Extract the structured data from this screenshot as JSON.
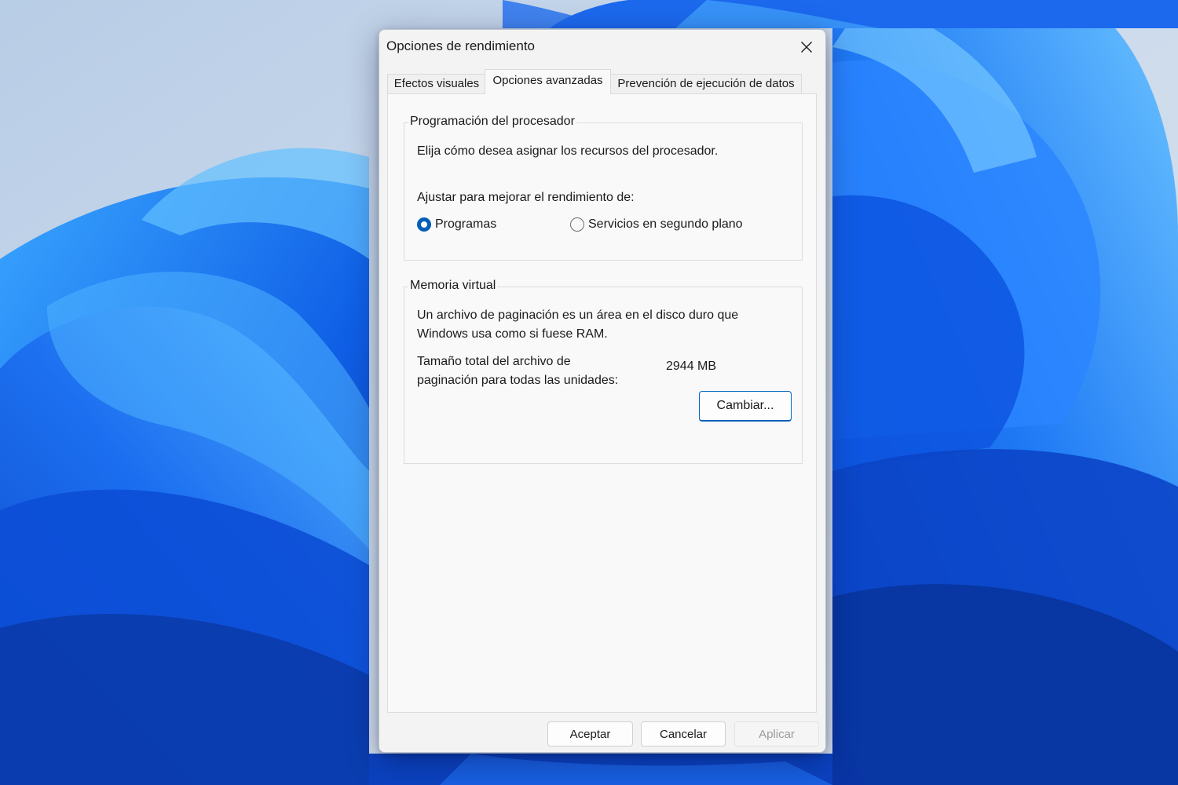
{
  "dialog": {
    "title": "Opciones de rendimiento",
    "tabs": [
      {
        "label": "Efectos visuales",
        "active": false
      },
      {
        "label": "Opciones avanzadas",
        "active": true
      },
      {
        "label": "Prevención de ejecución de datos",
        "active": false
      }
    ],
    "processor": {
      "group_title": "Programación del procesador",
      "description": "Elija cómo desea asignar los recursos del procesador.",
      "adjust_label": "Ajustar para mejorar el rendimiento de:",
      "options": [
        {
          "label": "Programas",
          "selected": true
        },
        {
          "label": "Servicios en segundo plano",
          "selected": false
        }
      ]
    },
    "virtual_memory": {
      "group_title": "Memoria virtual",
      "description_line1": "Un archivo de paginación es un área en el disco duro que",
      "description_line2": "Windows usa como si fuese RAM.",
      "total_label_line1": "Tamaño total del archivo de",
      "total_label_line2": "paginación para todas las unidades:",
      "total_value": "2944 MB",
      "change_button": "Cambiar..."
    },
    "footer": {
      "ok": "Aceptar",
      "cancel": "Cancelar",
      "apply": "Aplicar"
    }
  },
  "colors": {
    "accent": "#005fb8",
    "wallpaper_background": "#c9d9ec",
    "wallpaper_blue": "#1560e8"
  },
  "icons": {
    "close": "close-icon"
  }
}
